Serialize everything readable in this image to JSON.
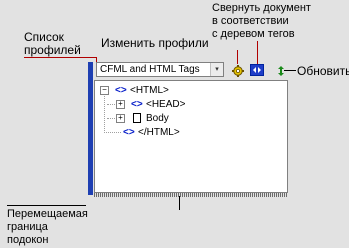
{
  "callouts": {
    "collapse_line1": "Свернуть документ",
    "collapse_line2": "в соответствии",
    "collapse_line3": "с деревом тегов",
    "profile_list_line1": "Список",
    "profile_list_line2": "профилей",
    "edit_profiles": "Изменить профили",
    "refresh": "Обновить",
    "splitter_line1": "Перемещаемая",
    "splitter_line2": "граница",
    "splitter_line3": "подокон"
  },
  "toolbar": {
    "profile_value": "CFML and HTML Tags",
    "dropdown_arrow": "▾",
    "edit_icon": "gear-icon",
    "sync_icon": "tag-tree-sync-icon",
    "refresh_icon": "refresh-icon"
  },
  "tree": {
    "expanders": {
      "root": "−",
      "head": "+",
      "body": "+"
    },
    "tag_glyph": "<>",
    "nodes": [
      {
        "label": "<HTML>"
      },
      {
        "label": "<HEAD>"
      },
      {
        "label": "Body"
      },
      {
        "label": "</HTML>"
      }
    ]
  },
  "colors": {
    "splitter": "#1e3fb2",
    "callout_line": "#b00000",
    "tag_icon": "#0018c8",
    "sync_button": "#1e3dc8"
  }
}
